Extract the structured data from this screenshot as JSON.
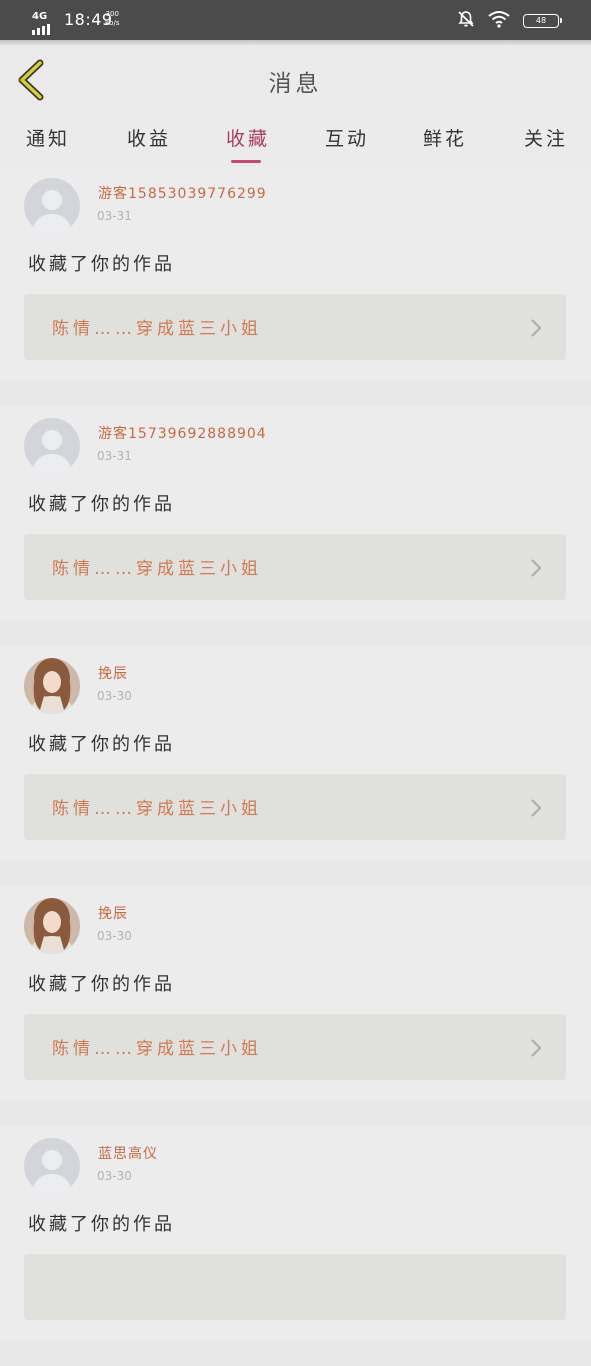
{
  "status_bar": {
    "network": "4G",
    "time": "18:49",
    "speed_value": "300",
    "speed_unit": "kb/s",
    "battery_level": "48",
    "icons": [
      "signal-icon",
      "mute-icon",
      "wifi-icon",
      "battery-icon"
    ]
  },
  "header": {
    "title": "消息",
    "back_icon": "back-arrow-icon"
  },
  "tabs": [
    {
      "label": "通知"
    },
    {
      "label": "收益"
    },
    {
      "label": "收藏"
    },
    {
      "label": "互动"
    },
    {
      "label": "鲜花"
    },
    {
      "label": "关注"
    }
  ],
  "active_tab": "收藏",
  "items": [
    {
      "username": "游客15853039776299",
      "date": "03-31",
      "action": "收藏了你的作品",
      "work_title": "陈情……穿成蓝三小姐",
      "avatar": "default-avatar-icon"
    },
    {
      "username": "游客15739692888904",
      "date": "03-31",
      "action": "收藏了你的作品",
      "work_title": "陈情……穿成蓝三小姐",
      "avatar": "default-avatar-icon"
    },
    {
      "username": "挽辰",
      "date": "03-30",
      "action": "收藏了你的作品",
      "work_title": "陈情……穿成蓝三小姐",
      "avatar": "photo-avatar"
    },
    {
      "username": "挽辰",
      "date": "03-30",
      "action": "收藏了你的作品",
      "work_title": "陈情……穿成蓝三小姐",
      "avatar": "photo-avatar"
    },
    {
      "username": "蓝思高仪",
      "date": "03-30",
      "action": "收藏了你的作品",
      "work_title": "",
      "avatar": "default-avatar-icon"
    }
  ],
  "colors": {
    "accent": "#c24a6d",
    "username": "#c46a45",
    "work_title": "#cf7a52"
  }
}
